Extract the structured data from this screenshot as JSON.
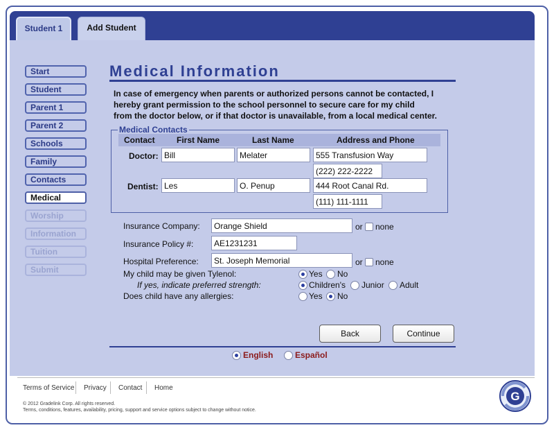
{
  "tabs": {
    "student": "Student 1",
    "add": "Add Student"
  },
  "sidebar": {
    "items": [
      {
        "label": "Start",
        "state": "normal"
      },
      {
        "label": "Student",
        "state": "normal"
      },
      {
        "label": "Parent 1",
        "state": "normal"
      },
      {
        "label": "Parent 2",
        "state": "normal"
      },
      {
        "label": "Schools",
        "state": "normal"
      },
      {
        "label": "Family",
        "state": "normal"
      },
      {
        "label": "Contacts",
        "state": "normal"
      },
      {
        "label": "Medical",
        "state": "active"
      },
      {
        "label": "Worship",
        "state": "disabled"
      },
      {
        "label": "Information",
        "state": "disabled"
      },
      {
        "label": "Tuition",
        "state": "disabled"
      },
      {
        "label": "Submit",
        "state": "disabled"
      }
    ]
  },
  "page": {
    "title": "Medical Information",
    "consent_lines": [
      "In case of emergency when parents or authorized persons cannot be contacted, I",
      "hereby grant permission to the school personnel to secure care for my child",
      "from the doctor below, or if that doctor is unavailable, from a local medical center."
    ]
  },
  "medical_contacts": {
    "legend": "Medical Contacts",
    "headers": [
      "Contact",
      "First Name",
      "Last Name",
      "Address and Phone"
    ],
    "doctor": {
      "label": "Doctor:",
      "first": "Bill",
      "last": "Melater",
      "address": "555 Transfusion Way",
      "phone": "(222) 222-2222"
    },
    "dentist": {
      "label": "Dentist:",
      "first": "Les",
      "last": "O. Penup",
      "address": "444 Root Canal Rd.",
      "phone": "(111) 111-1111"
    }
  },
  "insurance": {
    "company_label": "Insurance Company:",
    "company_value": "Orange Shield",
    "or_text": "or",
    "none_text": "none",
    "policy_label": "Insurance Policy #:",
    "policy_value": "AE1231231",
    "hospital_label": "Hospital Preference:",
    "hospital_value": "St. Joseph Memorial"
  },
  "questions": {
    "tylenol_label": "My child may be given Tylenol:",
    "strength_label": "If yes, indicate preferred strength:",
    "allergies_label": "Does child have any allergies:",
    "yes": "Yes",
    "no": "No",
    "childrens": "Children's",
    "junior": "Junior",
    "adult": "Adult",
    "tylenol_selected": "Yes",
    "strength_selected": "Children's",
    "allergies_selected": "No"
  },
  "buttons": {
    "back": "Back",
    "continue": "Continue"
  },
  "language": {
    "english": "English",
    "espanol": "Español",
    "selected": "English"
  },
  "footer": {
    "links": [
      "Terms of Service",
      "Privacy",
      "Contact",
      "Home"
    ],
    "copyright": "© 2012 Gradelink Corp. All rights reserved.",
    "terms": "Terms, conditions, features, availability, pricing, support and service options subject to change without notice."
  },
  "colors": {
    "brand": "#2f4093",
    "panel": "#c4cbe9",
    "language": "#8b1a1a"
  }
}
